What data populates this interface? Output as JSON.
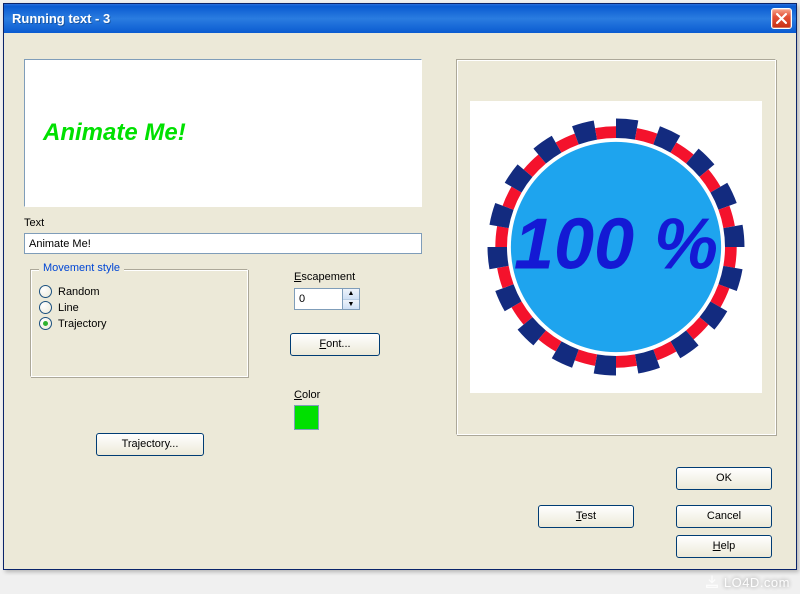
{
  "window": {
    "title": "Running text - 3"
  },
  "preview": {
    "sample_text": "Animate Me!",
    "sample_color": "#00e000"
  },
  "text": {
    "label": "Text",
    "value": "Animate Me!"
  },
  "movement": {
    "legend": "Movement style",
    "options": {
      "random": "Random",
      "line": "Line",
      "trajectory": "Trajectory"
    },
    "selected": "trajectory",
    "trajectory_button": "Trajectory..."
  },
  "escapement": {
    "label": "Escapement",
    "value": "0"
  },
  "font_button": "Font...",
  "color": {
    "label": "Color",
    "swatch": "#00e000"
  },
  "badge": {
    "text": "100 %",
    "fill": "#1ea4ee",
    "ring_a": "#132b7f",
    "ring_b": "#f4122c",
    "text_color": "#1419d4"
  },
  "buttons": {
    "test": "Test",
    "ok": "OK",
    "cancel": "Cancel",
    "help": "Help"
  },
  "watermark": "LO4D.com"
}
